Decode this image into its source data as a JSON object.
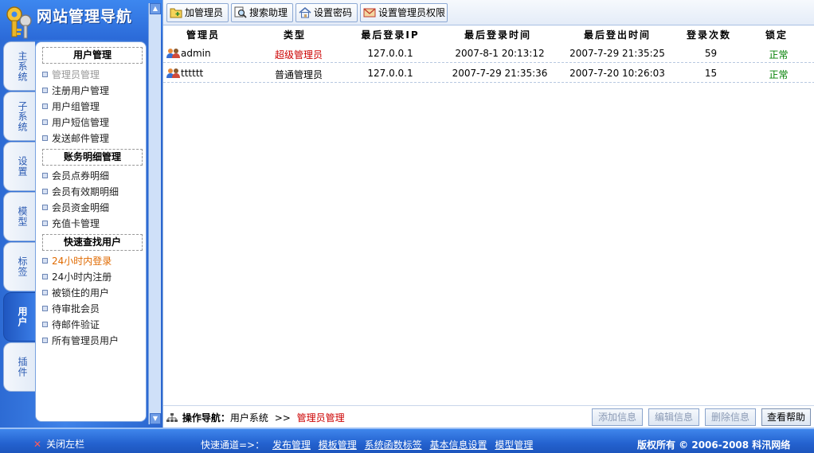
{
  "nav": {
    "title": "网站管理导航",
    "tabs": [
      "主系统",
      "子系统",
      "设置",
      "模型",
      "标签",
      "用户",
      "插件"
    ],
    "groups": [
      {
        "title": "用户管理",
        "items": [
          "管理员管理",
          "注册用户管理",
          "用户组管理",
          "用户短信管理",
          "发送邮件管理"
        ]
      },
      {
        "title": "账务明细管理",
        "items": [
          "会员点券明细",
          "会员有效期明细",
          "会员资金明细",
          "充值卡管理"
        ]
      },
      {
        "title": "快速查找用户",
        "items": [
          "24小时内登录",
          "24小时内注册",
          "被锁住的用户",
          "待审批会员",
          "待邮件验证",
          "所有管理员用户"
        ]
      }
    ]
  },
  "toolbar": {
    "add_admin": "加管理员",
    "search_helper": "搜索助理",
    "set_password": "设置密码",
    "set_permissions": "设置管理员权限"
  },
  "table": {
    "headers": [
      "管理员",
      "类型",
      "最后登录IP",
      "最后登录时间",
      "最后登出时间",
      "登录次数",
      "锁定"
    ],
    "rows": [
      {
        "name": "admin",
        "type": "超级管理员",
        "ip": "127.0.0.1",
        "login": "2007-8-1 20:13:12",
        "logout": "2007-7-29 21:35:25",
        "count": "59",
        "status": "正常"
      },
      {
        "name": "tttttt",
        "type": "普通管理员",
        "ip": "127.0.0.1",
        "login": "2007-7-29 21:35:36",
        "logout": "2007-7-20 10:26:03",
        "count": "15",
        "status": "正常"
      }
    ]
  },
  "navbar": {
    "label": "操作导航：",
    "crumb1": "用户系统",
    "sep": ">>",
    "crumb2": "管理员管理",
    "buttons": [
      "添加信息",
      "编辑信息",
      "删除信息",
      "查看帮助"
    ]
  },
  "footer": {
    "close_left": "关闭左栏",
    "quick_label": "快速通道=>：",
    "links": [
      "发布管理",
      "模板管理",
      "系统函数标签",
      "基本信息设置",
      "模型管理"
    ],
    "copyright": "版权所有 © 2006-2008 科汛网络"
  },
  "colors": {
    "accent": "#2a66cf",
    "red": "#cc0000",
    "green": "#008000",
    "orange": "#e06a00"
  }
}
